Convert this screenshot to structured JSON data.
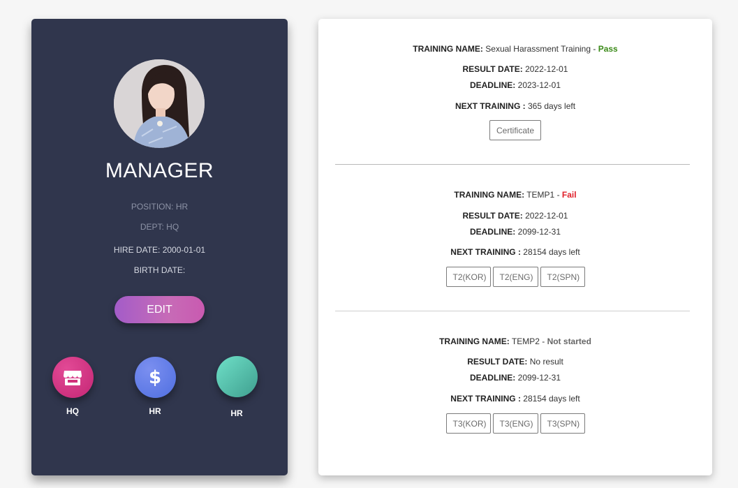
{
  "profile": {
    "title": "MANAGER",
    "position": "POSITION: HR",
    "dept": "DEPT: HQ",
    "hire_date": "HIRE DATE: 2000-01-01",
    "birth_date": "BIRTH DATE:",
    "edit_label": "EDIT",
    "shortcuts": [
      {
        "label": "HQ",
        "icon": "store-icon",
        "color": "#d1307a"
      },
      {
        "label": "HR",
        "icon": "dollar-icon",
        "color": "#5b7ee8"
      },
      {
        "label": "HR",
        "icon": "none",
        "color": "#4fbfa6"
      }
    ]
  },
  "trainings": [
    {
      "name_label": "TRAINING NAME:",
      "name": "Sexual Harassment Training",
      "status": "Pass",
      "result_label": "RESULT DATE:",
      "result_date": "2022-12-01",
      "deadline_label": "DEADLINE:",
      "deadline": "2023-12-01",
      "next_label": "NEXT TRAINING :",
      "next": "365 days left",
      "buttons": [
        "Certificate"
      ]
    },
    {
      "name_label": "TRAINING NAME:",
      "name": "TEMP1",
      "status": "Fail",
      "result_label": "RESULT DATE:",
      "result_date": "2022-12-01",
      "deadline_label": "DEADLINE:",
      "deadline": "2099-12-31",
      "next_label": "NEXT TRAINING :",
      "next": "28154 days left",
      "buttons": [
        "T2(KOR)",
        "T2(ENG)",
        "T2(SPN)"
      ]
    },
    {
      "name_label": "TRAINING NAME:",
      "name": "TEMP2",
      "status": "Not started",
      "result_label": "RESULT DATE:",
      "result_date": "No result",
      "deadline_label": "DEADLINE:",
      "deadline": "2099-12-31",
      "next_label": "NEXT TRAINING :",
      "next": "28154 days left",
      "buttons": [
        "T3(KOR)",
        "T3(ENG)",
        "T3(SPN)"
      ]
    }
  ]
}
